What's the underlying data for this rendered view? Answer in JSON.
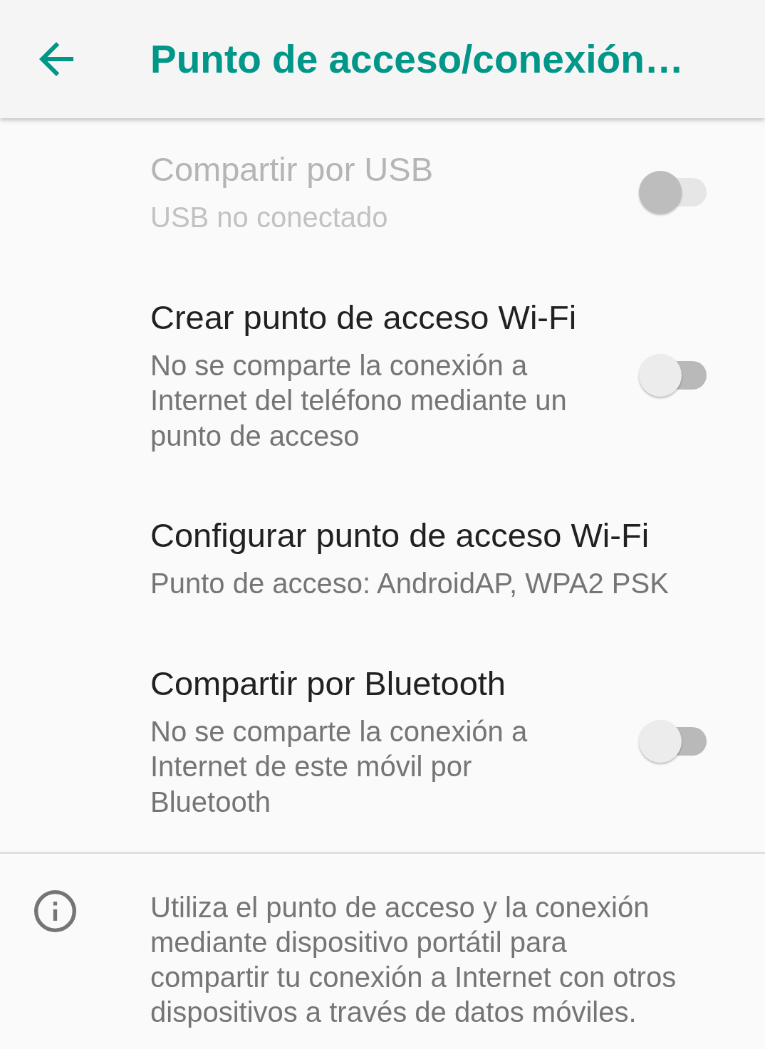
{
  "app_bar": {
    "title": "Punto de acceso/conexión…"
  },
  "settings": [
    {
      "kind": "switch",
      "title": "Compartir por USB",
      "summary": "USB no conectado",
      "disabled": true,
      "on": false
    },
    {
      "kind": "switch",
      "title": "Crear punto de acceso Wi-Fi",
      "summary": "No se comparte la conexión a Internet del teléfono mediante un punto de acceso",
      "disabled": false,
      "on": false
    },
    {
      "kind": "link",
      "title": "Configurar punto de acceso Wi-Fi",
      "summary": "Punto de acceso: AndroidAP, WPA2 PSK",
      "disabled": false
    },
    {
      "kind": "switch",
      "title": "Compartir por Bluetooth",
      "summary": "No se comparte la conexión a Internet de este móvil por Bluetooth",
      "disabled": false,
      "on": false
    }
  ],
  "footer": {
    "text": "Utiliza el punto de acceso y la conexión mediante dispositivo portátil para compartir tu conexión a Internet con otros dispositivos a través de datos móviles."
  }
}
